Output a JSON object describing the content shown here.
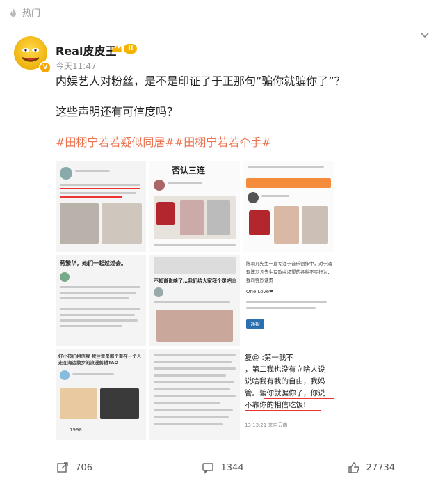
{
  "header": {
    "hot_label": "热门"
  },
  "post": {
    "author": "Real皮皮王",
    "level_badge": "II",
    "time": "今天11:47",
    "text_line1": "内娱艺人对粉丝，是不是印证了于正那句“骗你就骗你了”？",
    "text_line2": "这些声明还有可信度吗？",
    "hashtags": "#田栩宁若若疑似同居##田栩宁若若牵手#"
  },
  "images": {
    "img2_title": "否认三连",
    "img4_caption": "蒋繁华，她们一起过过会。",
    "img5_caption": "不知道说啥了…我们给大家拜个灵吧😅",
    "img6_text1": "陈羽凡先生一直专注于音乐创作中，对于涌",
    "img6_text2": "现陈羽凡先生及歌曲渴望的各种不实行为，",
    "img6_text3": "我司强烈谴责",
    "img6_love": "One Love❤",
    "img6_badge": "通报",
    "img7_text": "好小孩们相信我 我注意是那个重在一个人走在海边散步的浪漫剪辑TAO",
    "img7_count": "1998",
    "img9_l1": "复@      :第一我不",
    "img9_l2": "，第二我也没有立啥人设",
    "img9_l3": "说啥我有我的自由，我妈",
    "img9_l4": "管。骗你就骗你了，你说",
    "img9_l5": "不靠你的相信吃饭!",
    "img9_time": "13 13:21  来自云南"
  },
  "actions": {
    "repost": "706",
    "comment": "1344",
    "like": "27734"
  },
  "colors": {
    "hashtag": "#eb7350",
    "badge": "#f5b400",
    "underline": "#e33333"
  }
}
